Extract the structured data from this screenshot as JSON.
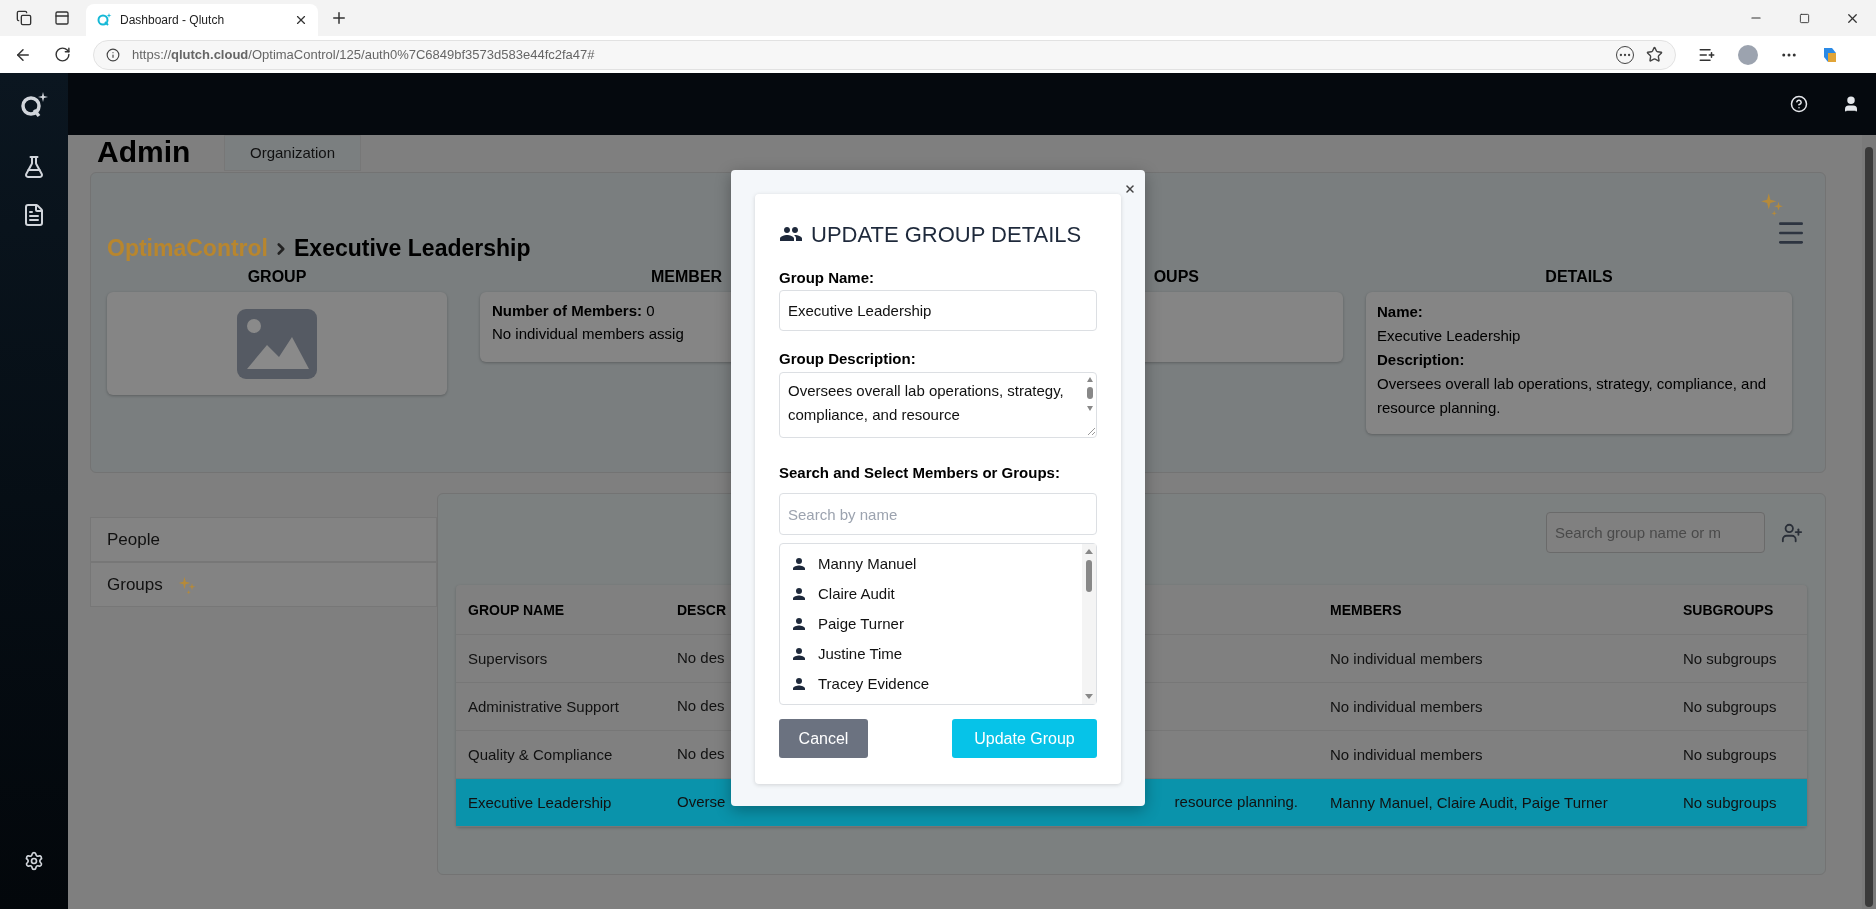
{
  "browser": {
    "tab_title": "Dashboard - Qlutch",
    "url": "https://**qlutch.cloud**/OptimaControl/125/auth0%7C6849bf3573d583e44fc2fa47#"
  },
  "page": {
    "title": "Admin",
    "tabs": [
      "Organization"
    ]
  },
  "group_panel": {
    "breadcrumb": {
      "parent": "OptimaControl",
      "current": "Executive Leadership"
    },
    "columns": [
      {
        "kind": "image",
        "heading": "GROUP"
      },
      {
        "kind": "members",
        "heading": "MEMBER",
        "label": "Number of Members:",
        "value": "0",
        "note": "No individual members assig"
      },
      {
        "kind": "subgroups",
        "heading": "OUPS"
      },
      {
        "kind": "details",
        "heading": "DETAILS",
        "name_label": "Name:",
        "name": "Executive Leadership",
        "description_label": "Description:",
        "description": "Oversees overall lab operations, strategy, compliance, and resource planning."
      }
    ]
  },
  "nav": [
    {
      "label": "People",
      "sparkle": false
    },
    {
      "label": "Groups",
      "sparkle": true
    }
  ],
  "table": {
    "search_placeholder": "Search group name or m",
    "columns": [
      "GROUP NAME",
      "DESCR",
      "MEMBERS",
      "SUBGROUPS"
    ],
    "rows": [
      {
        "name": "Supervisors",
        "description": "No des",
        "members": "No individual members",
        "subgroups": "No subgroups",
        "selected": false
      },
      {
        "name": "Administrative Support",
        "description": "No des",
        "members": "No individual members",
        "subgroups": "No subgroups",
        "selected": false
      },
      {
        "name": "Quality & Compliance",
        "description": "No des",
        "members": "No individual members",
        "subgroups": "No subgroups",
        "selected": false
      },
      {
        "name": "Executive Leadership",
        "description": "Overse",
        "description_tail": "resource planning.",
        "members": "Manny Manuel, Claire Audit, Paige Turner",
        "subgroups": "No subgroups",
        "selected": true
      }
    ]
  },
  "modal": {
    "title": "UPDATE GROUP DETAILS",
    "name_label": "Group Name:",
    "name_value": "Executive Leadership",
    "description_label": "Group Description:",
    "description_value": "Oversees overall lab operations, strategy, compliance, and resource",
    "search_label": "Search and Select Members or Groups:",
    "search_placeholder": "Search by name",
    "people": [
      "Manny Manuel",
      "Claire Audit",
      "Paige Turner",
      "Justine Time",
      "Tracey Evidence"
    ],
    "buttons": [
      {
        "kind": "cancel",
        "label": "Cancel"
      },
      {
        "kind": "submit",
        "label": "Update Group"
      }
    ]
  }
}
